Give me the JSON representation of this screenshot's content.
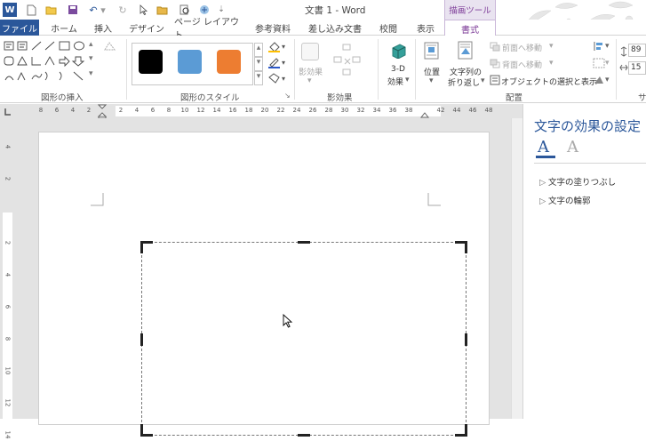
{
  "title_bar": {
    "doc_title": "文書 1 - Word",
    "context_tab_title": "描画ツール",
    "app_icon_letter": "W",
    "qa_icons": [
      "new-document-icon",
      "open-folder-icon",
      "save-icon",
      "undo-icon",
      "redo-icon",
      "cursor-icon",
      "folder-icon",
      "print-preview-icon",
      "share-icon",
      "customize-icon"
    ]
  },
  "tabs": {
    "file": "ファイル",
    "home": "ホーム",
    "insert": "挿入",
    "design": "デザイン",
    "page_layout": "ページ レイアウト",
    "references": "参考資料",
    "mailings": "差し込み文書",
    "review": "校閲",
    "view": "表示",
    "format": "書式"
  },
  "ribbon": {
    "insert_shapes_label": "図形の挿入",
    "shape_styles_label": "図形のスタイル",
    "shadow_effects_label": "影効果",
    "arrange_label": "配置",
    "shadow_button": "影効果",
    "effects_3d_line1": "3-D",
    "effects_3d_line2": "効果",
    "position_button": "位置",
    "wrap_text_line1": "文字列の",
    "wrap_text_line2": "折り返し",
    "bring_forward": "前面へ移動",
    "send_backward": "背面へ移動",
    "selection_pane": "オブジェクトの選択と表示",
    "size_label_partial": "サ",
    "size_height": "89",
    "size_width": "15",
    "style_swatches": [
      {
        "name": "black-style",
        "color": "#000000"
      },
      {
        "name": "blue-style",
        "color": "#5b9bd5"
      },
      {
        "name": "orange-style",
        "color": "#ed7d31"
      }
    ]
  },
  "rulers": {
    "horizontal": [
      "8",
      "6",
      "4",
      "2",
      "",
      "2",
      "4",
      "6",
      "8",
      "10",
      "12",
      "14",
      "16",
      "18",
      "20",
      "22",
      "24",
      "26",
      "28",
      "30",
      "32",
      "34",
      "36",
      "38",
      "",
      "42",
      "44",
      "46",
      "48"
    ],
    "vertical": [
      "4",
      "2",
      "",
      "2",
      "4",
      "6",
      "8",
      "10",
      "12",
      "14"
    ]
  },
  "panel": {
    "title": "文字の効果の設定",
    "fill_tab_glyph": "A",
    "effect_tab_glyph": "A",
    "items": [
      "文字の塗りつぶし",
      "文字の輪郭"
    ]
  },
  "colors": {
    "brand": "#2b579a",
    "context": "#7d3c98"
  }
}
